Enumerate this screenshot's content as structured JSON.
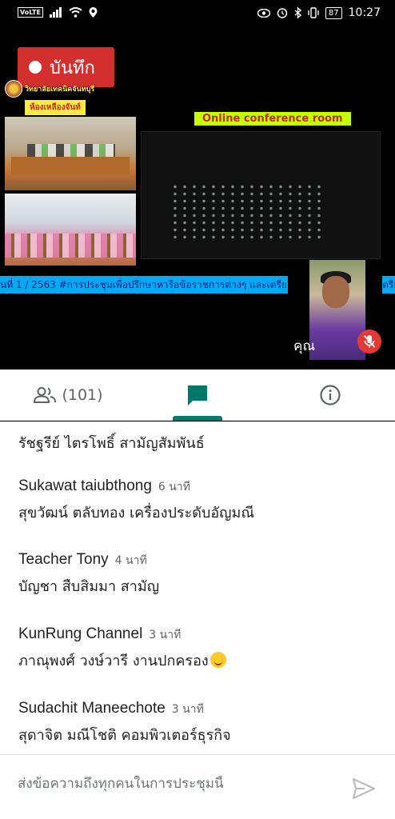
{
  "status_bar": {
    "volte": "VoLTE",
    "battery": "87",
    "time": "10:27"
  },
  "video": {
    "record_label": "บันทึก",
    "college_name": "วิทยาลัยเทคนิคจันทบุรี",
    "room_label": "ห้องเหลืองจันท์",
    "online_label": "Online conference room",
    "ticker_text": "นที่ 1 / 2563     #การประชุมเพื่อปรึกษาหารือข้อราชการต่างๆ และเตรีย",
    "ticker_tail": "ตรีย",
    "self_label": "คุณ"
  },
  "tabs": {
    "people_count": "(101)"
  },
  "chat": {
    "messages": [
      {
        "name": "",
        "time": "",
        "text": "รัชฐรีย์ ไตรโพธิ์ สามัญสัมพันธ์"
      },
      {
        "name": "Sukawat taiubthong",
        "time": "6 นาที",
        "text": "สุขวัฒน์ ตลับทอง เครื่องประดับอัญมณี"
      },
      {
        "name": "Teacher Tony",
        "time": "4 นาที",
        "text": "บัญชา สืบสิมมา สามัญ"
      },
      {
        "name": "KunRung Channel",
        "time": "3 นาที",
        "text": "ภาณุพงศ์ วงษ์วารี งานปกครอง"
      },
      {
        "name": "Sudachit Maneechote",
        "time": "3 นาที",
        "text": "สุดาจิต  มณีโชติ  คอมพิวเตอร์ธุรกิจ"
      }
    ]
  },
  "composer": {
    "placeholder": "ส่งข้อความถึงทุกคนในการประชุมนี้"
  },
  "colors": {
    "record": "#d32f2f",
    "accent": "#00796b",
    "ticker": "#03a9f4",
    "online_label_bg": "#c6ff00"
  },
  "icons": [
    "wifi-icon",
    "signal-icon",
    "location-icon",
    "eye-icon",
    "alarm-icon",
    "bluetooth-icon",
    "vibrate-icon",
    "battery-icon",
    "people-icon",
    "chat-icon",
    "info-icon",
    "mic-off-icon",
    "send-icon",
    "emoji-hug-icon"
  ]
}
